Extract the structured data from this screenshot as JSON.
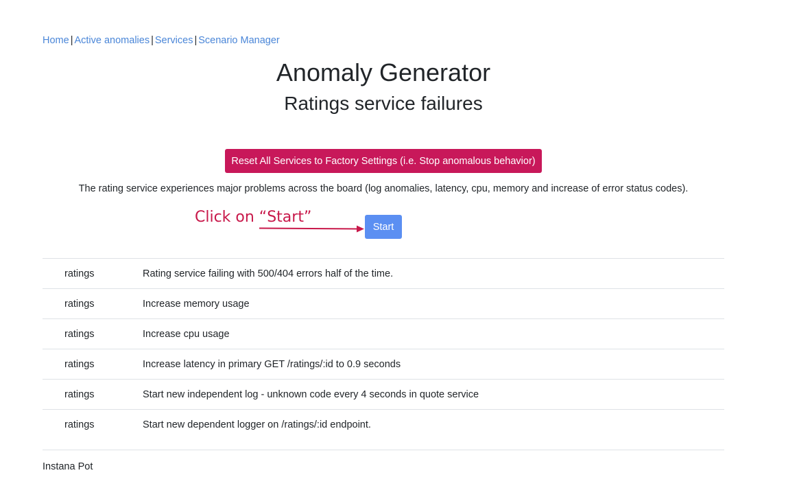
{
  "nav": {
    "items": [
      {
        "label": "Home"
      },
      {
        "label": "Active anomalies"
      },
      {
        "label": "Services"
      },
      {
        "label": "Scenario Manager"
      }
    ],
    "separator": "|"
  },
  "header": {
    "title": "Anomaly Generator",
    "subtitle": "Ratings service failures"
  },
  "reset_button_label": "Reset All Services to Factory Settings (i.e. Stop anomalous behavior)",
  "description": "The rating service experiences major problems across the board (log anomalies, latency, cpu, memory and increase of error status codes).",
  "annotation": {
    "text": "Click on “Start”",
    "color": "#c8184a"
  },
  "start_button_label": "Start",
  "anomalies": [
    {
      "service": "ratings",
      "action": "Rating service failing with 500/404 errors half of the time."
    },
    {
      "service": "ratings",
      "action": "Increase memory usage"
    },
    {
      "service": "ratings",
      "action": "Increase cpu usage"
    },
    {
      "service": "ratings",
      "action": "Increase latency in primary GET /ratings/:id to 0.9 seconds"
    },
    {
      "service": "ratings",
      "action": "Start new independent log - unknown code every 4 seconds in quote service"
    },
    {
      "service": "ratings",
      "action": "Start new dependent logger on /ratings/:id endpoint."
    }
  ],
  "footer": "Instana Pot",
  "colors": {
    "link": "#4a86d8",
    "reset_button": "#c8185a",
    "start_button": "#5b8ff2"
  }
}
